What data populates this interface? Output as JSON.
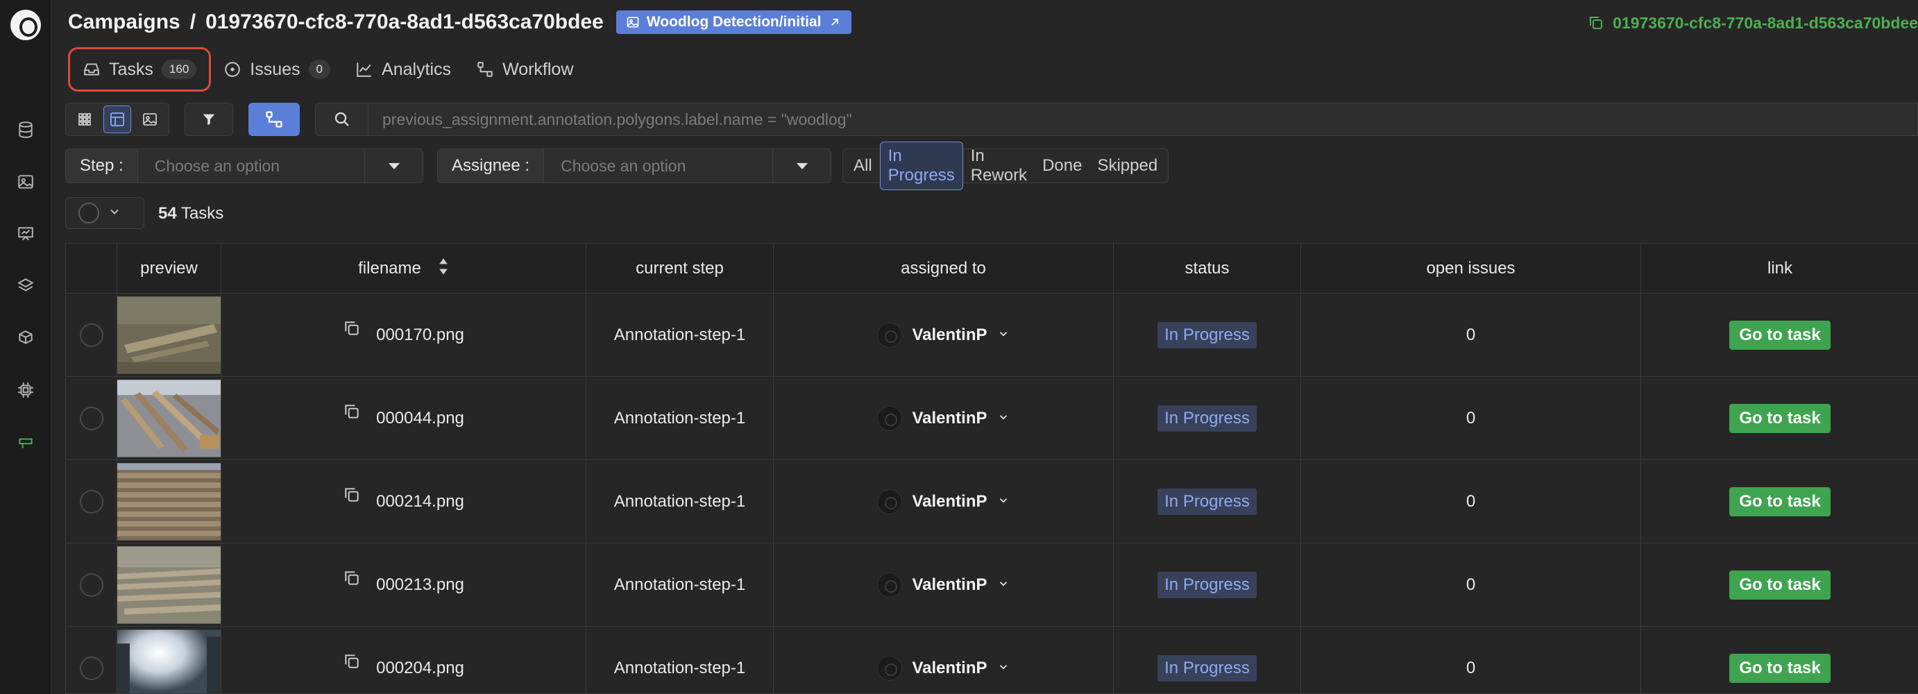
{
  "header": {
    "breadcrumb_root": "Campaigns",
    "separator": "/",
    "campaign_id": "01973670-cfc8-770a-8ad1-d563ca70bdee",
    "dataset_badge": "Woodlog Detection/initial",
    "copy_id_text": "01973670-cfc8-770a-8ad1-d563ca70bdee"
  },
  "tabs": [
    {
      "label": "Tasks",
      "count": "160",
      "highlighted": true
    },
    {
      "label": "Issues",
      "count": "0"
    },
    {
      "label": "Analytics"
    },
    {
      "label": "Workflow"
    }
  ],
  "search": {
    "placeholder": "previous_assignment.annotation.polygons.label.name = \"woodlog\""
  },
  "filters": {
    "step_label": "Step :",
    "step_placeholder": "Choose an option",
    "assignee_label": "Assignee :",
    "assignee_placeholder": "Choose an option",
    "status_options": [
      "All",
      "In Progress",
      "In Rework",
      "Done",
      "Skipped"
    ],
    "status_selected": "In Progress"
  },
  "task_count": {
    "number": "54",
    "label": "Tasks"
  },
  "table": {
    "columns": [
      "preview",
      "filename",
      "current step",
      "assigned to",
      "status",
      "open issues",
      "link"
    ],
    "rows": [
      {
        "filename": "000170.png",
        "current_step": "Annotation-step-1",
        "assigned_to": "ValentinP",
        "status": "In Progress",
        "open_issues": "0",
        "link": "Go to task"
      },
      {
        "filename": "000044.png",
        "current_step": "Annotation-step-1",
        "assigned_to": "ValentinP",
        "status": "In Progress",
        "open_issues": "0",
        "link": "Go to task"
      },
      {
        "filename": "000214.png",
        "current_step": "Annotation-step-1",
        "assigned_to": "ValentinP",
        "status": "In Progress",
        "open_issues": "0",
        "link": "Go to task"
      },
      {
        "filename": "000213.png",
        "current_step": "Annotation-step-1",
        "assigned_to": "ValentinP",
        "status": "In Progress",
        "open_issues": "0",
        "link": "Go to task"
      },
      {
        "filename": "000204.png",
        "current_step": "Annotation-step-1",
        "assigned_to": "ValentinP",
        "status": "In Progress",
        "open_issues": "0",
        "link": "Go to task"
      }
    ]
  },
  "sidebar": {
    "icons": [
      "database-icon",
      "image-icon",
      "training-icon",
      "layers-icon",
      "model-icon",
      "settings-chip-icon",
      "campaign-icon"
    ],
    "active": "campaign-icon"
  },
  "colors": {
    "accent_blue": "#5b7fd9",
    "success_green": "#3fa44f",
    "highlight_red": "#e0483a",
    "background": "#262626"
  }
}
